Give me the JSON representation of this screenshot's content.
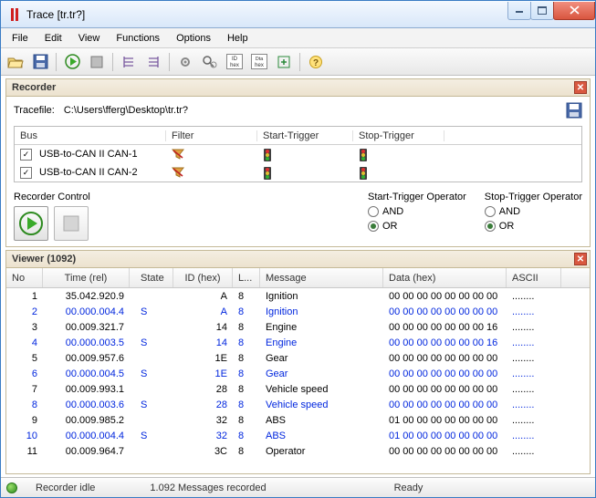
{
  "window": {
    "title": "Trace [tr.tr?]"
  },
  "menu": {
    "file": "File",
    "edit": "Edit",
    "view": "View",
    "functions": "Functions",
    "options": "Options",
    "help": "Help"
  },
  "recorder": {
    "header": "Recorder",
    "tracefile_label": "Tracefile:",
    "tracefile_path": "C:\\Users\\fferg\\Desktop\\tr.tr?",
    "columns": {
      "bus": "Bus",
      "filter": "Filter",
      "start": "Start-Trigger",
      "stop": "Stop-Trigger"
    },
    "rows": [
      {
        "checked": true,
        "bus": "USB-to-CAN II  CAN-1",
        "filter": "<No Filter>",
        "start": "<No Trigger>",
        "stop": "<No Trigger>"
      },
      {
        "checked": true,
        "bus": "USB-to-CAN II  CAN-2",
        "filter": "<No Filter>",
        "start": "<No Trigger>",
        "stop": "<No Trigger>"
      }
    ],
    "control_label": "Recorder Control",
    "start_op_label": "Start-Trigger Operator",
    "stop_op_label": "Stop-Trigger Operator",
    "and": "AND",
    "or": "OR",
    "start_op": "OR",
    "stop_op": "OR"
  },
  "viewer": {
    "header": "Viewer (1092)",
    "columns": {
      "no": "No",
      "time": "Time (rel)",
      "state": "State",
      "id": "ID (hex)",
      "len": "L...",
      "msg": "Message",
      "data": "Data (hex)",
      "ascii": "ASCII"
    },
    "rows": [
      {
        "no": "1",
        "time": "35.042.920.9",
        "state": "",
        "id": "A",
        "len": "8",
        "msg": "Ignition",
        "data": "00 00 00 00 00 00 00 00",
        "ascii": "........",
        "blue": false
      },
      {
        "no": "2",
        "time": "00.000.004.4",
        "state": "S",
        "id": "A",
        "len": "8",
        "msg": "Ignition",
        "data": "00 00 00 00 00 00 00 00",
        "ascii": "........",
        "blue": true
      },
      {
        "no": "3",
        "time": "00.009.321.7",
        "state": "",
        "id": "14",
        "len": "8",
        "msg": "Engine",
        "data": "00 00 00 00 00 00 00 16",
        "ascii": "........",
        "blue": false
      },
      {
        "no": "4",
        "time": "00.000.003.5",
        "state": "S",
        "id": "14",
        "len": "8",
        "msg": "Engine",
        "data": "00 00 00 00 00 00 00 16",
        "ascii": "........",
        "blue": true
      },
      {
        "no": "5",
        "time": "00.009.957.6",
        "state": "",
        "id": "1E",
        "len": "8",
        "msg": "Gear",
        "data": "00 00 00 00 00 00 00 00",
        "ascii": "........",
        "blue": false
      },
      {
        "no": "6",
        "time": "00.000.004.5",
        "state": "S",
        "id": "1E",
        "len": "8",
        "msg": "Gear",
        "data": "00 00 00 00 00 00 00 00",
        "ascii": "........",
        "blue": true
      },
      {
        "no": "7",
        "time": "00.009.993.1",
        "state": "",
        "id": "28",
        "len": "8",
        "msg": "Vehicle speed",
        "data": "00 00 00 00 00 00 00 00",
        "ascii": "........",
        "blue": false
      },
      {
        "no": "8",
        "time": "00.000.003.6",
        "state": "S",
        "id": "28",
        "len": "8",
        "msg": "Vehicle speed",
        "data": "00 00 00 00 00 00 00 00",
        "ascii": "........",
        "blue": true
      },
      {
        "no": "9",
        "time": "00.009.985.2",
        "state": "",
        "id": "32",
        "len": "8",
        "msg": "ABS",
        "data": "01 00 00 00 00 00 00 00",
        "ascii": "........",
        "blue": false
      },
      {
        "no": "10",
        "time": "00.000.004.4",
        "state": "S",
        "id": "32",
        "len": "8",
        "msg": "ABS",
        "data": "01 00 00 00 00 00 00 00",
        "ascii": "........",
        "blue": true
      },
      {
        "no": "11",
        "time": "00.009.964.7",
        "state": "",
        "id": "3C",
        "len": "8",
        "msg": "Operator",
        "data": "00 00 00 00 00 00 00 00",
        "ascii": "........",
        "blue": false
      }
    ]
  },
  "status": {
    "idle": "Recorder idle",
    "count": "1.092 Messages recorded",
    "ready": "Ready"
  }
}
